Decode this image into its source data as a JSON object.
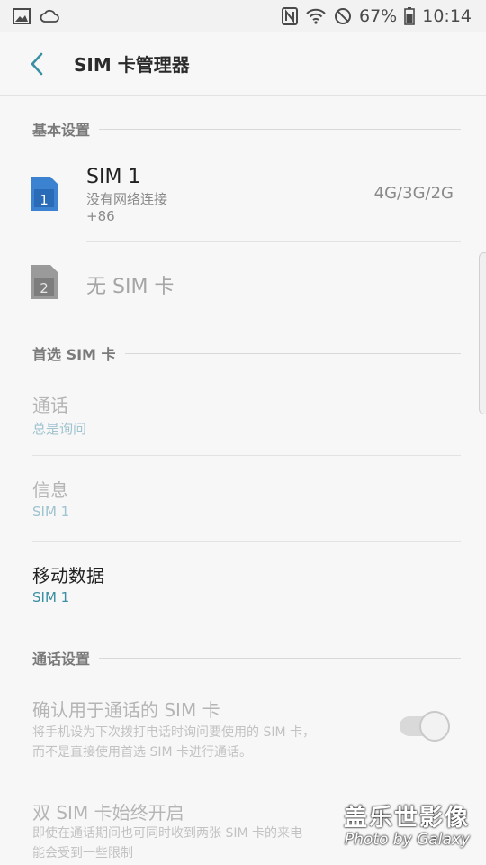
{
  "status_bar": {
    "icons_left": [
      "gallery-icon",
      "cloud-icon"
    ],
    "icons_right": [
      "nfc-icon",
      "wifi-icon",
      "blocked-icon",
      "battery-icon"
    ],
    "battery": "67%",
    "time": "10:14"
  },
  "app_bar": {
    "title": "SIM 卡管理器",
    "back_icon": "back-arrow-icon"
  },
  "sections": {
    "basic": "基本设置",
    "preferred": "首选 SIM 卡",
    "call_settings": "通话设置"
  },
  "sims": [
    {
      "slot": "1",
      "name": "SIM 1",
      "status": "没有网络连接",
      "number": "+86",
      "network": "4G/3G/2G",
      "color": "#3b83d1"
    },
    {
      "slot": "2",
      "name": "无 SIM 卡",
      "color": "#9a9a9a"
    }
  ],
  "preferred": {
    "call": {
      "title": "通话",
      "value": "总是询问"
    },
    "message": {
      "title": "信息",
      "value": "SIM 1"
    },
    "data": {
      "title": "移动数据",
      "value": "SIM 1"
    }
  },
  "call_settings": {
    "confirm": {
      "title": "确认用于通话的 SIM 卡",
      "desc1": "将手机设为下次拨打电话时询问要使用的 SIM 卡，",
      "desc2": "而不是直接使用首选 SIM 卡进行通话。",
      "toggle_on": false
    },
    "dual": {
      "title": "双 SIM 卡始终开启",
      "desc1": "即使在通话期间也可同时收到两张 SIM 卡的来电",
      "desc2": "能会受到一些限制"
    }
  },
  "watermark": {
    "line1": "盖乐世影像",
    "line2": "Photo by Galaxy"
  }
}
